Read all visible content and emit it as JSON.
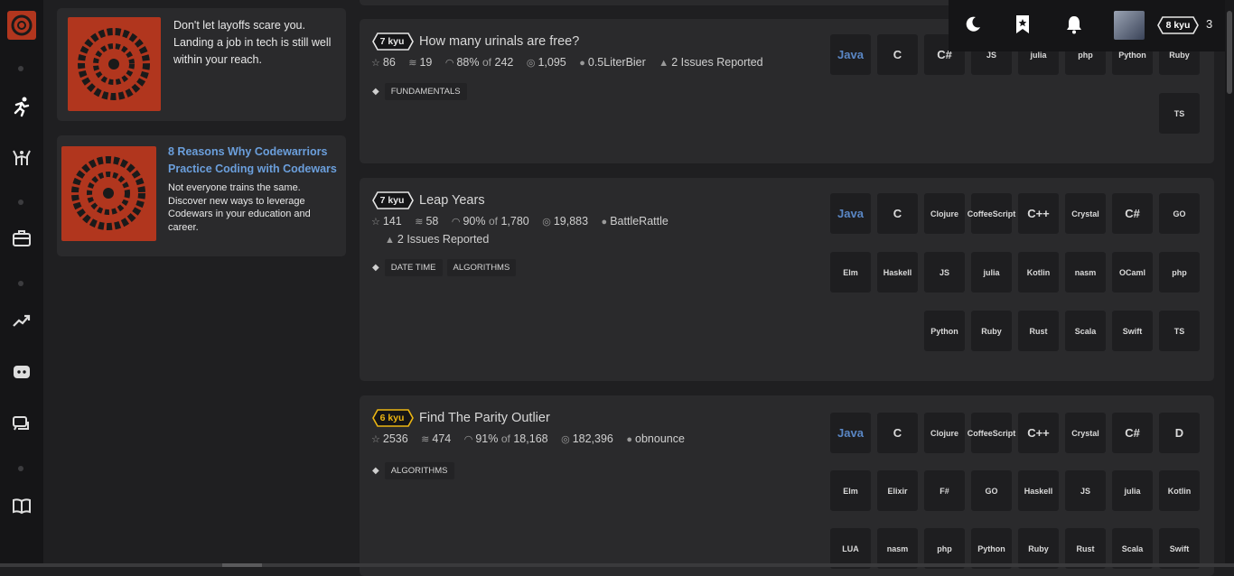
{
  "colors": {
    "brand": "#b1361e",
    "link": "#6b9fdc",
    "kyu7": "#e6e6e6",
    "kyu6": "#ecb613"
  },
  "nav": {
    "icons": [
      "codewars-logo",
      "practice-icon",
      "train-icon",
      "jobs-icon",
      "leaders-icon",
      "discord-icon",
      "discuss-icon",
      "docs-icon"
    ]
  },
  "promos": [
    {
      "text": "Don't let layoffs scare you. Landing a job in tech is still well within your reach."
    },
    {
      "title": "8 Reasons Why Codewarriors Practice Coding with Codewars",
      "body": "Not everyone trains the same. Discover new ways to leverage Codewars in your education and career."
    }
  ],
  "topbar": {
    "rank": "8 kyu",
    "honor": "3"
  },
  "katas": [
    {
      "kyu": "7 kyu",
      "title": "How many urinals are free?",
      "stars": "86",
      "collections": "19",
      "satisfaction": "88%",
      "of": "of",
      "votes": "242",
      "completed": "1,095",
      "author": "0.5LiterBier",
      "issues": "2 Issues Reported",
      "tags": [
        "FUNDAMENTALS"
      ],
      "langs": [
        "Java",
        "C",
        "C#",
        "JS",
        "julia",
        "php",
        "Python",
        "Ruby",
        "TS"
      ]
    },
    {
      "kyu": "7 kyu",
      "title": "Leap Years",
      "stars": "141",
      "collections": "58",
      "satisfaction": "90%",
      "of": "of",
      "votes": "1,780",
      "completed": "19,883",
      "author": "BattleRattle",
      "issues": "2 Issues Reported",
      "tags": [
        "DATE TIME",
        "ALGORITHMS"
      ],
      "langs": [
        "Java",
        "C",
        "Clojure",
        "CoffeeScript",
        "C++",
        "Crystal",
        "C#",
        "GO",
        "Elm",
        "Haskell",
        "JS",
        "julia",
        "Kotlin",
        "nasm",
        "OCaml",
        "php",
        "Python",
        "Ruby",
        "Rust",
        "Scala",
        "Swift",
        "TS"
      ]
    },
    {
      "kyu": "6 kyu",
      "title": "Find The Parity Outlier",
      "stars": "2536",
      "collections": "474",
      "satisfaction": "91%",
      "of": "of",
      "votes": "18,168",
      "completed": "182,396",
      "author": "obnounce",
      "tags": [
        "ALGORITHMS"
      ],
      "langs": [
        "Java",
        "C",
        "Clojure",
        "CoffeeScript",
        "C++",
        "Crystal",
        "C#",
        "D",
        "Elm",
        "Elixir",
        "F#",
        "GO",
        "Haskell",
        "JS",
        "julia",
        "Kotlin",
        "LUA",
        "nasm",
        "php",
        "Python",
        "Ruby",
        "Rust",
        "Scala",
        "Swift"
      ]
    }
  ]
}
